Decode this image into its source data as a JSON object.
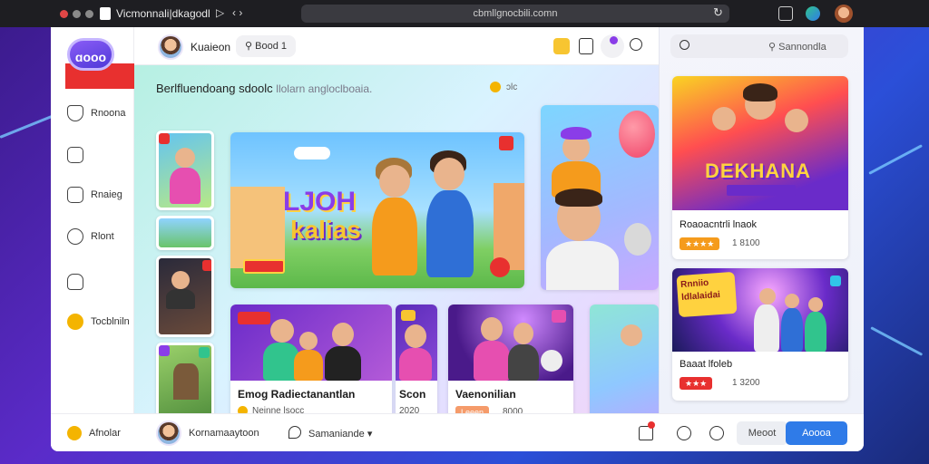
{
  "window": {
    "title": "Vicmonnali|dkagodl",
    "url": "cbmllgnocbili.comn"
  },
  "sidebar": {
    "logo": "ɑooo",
    "items": [
      {
        "label": "Rnoona",
        "icon": "shield-icon"
      },
      {
        "label": "",
        "icon": "home-icon"
      },
      {
        "label": "Rnaieg",
        "icon": "gift-icon"
      },
      {
        "label": "Rlont",
        "icon": "smile-icon"
      },
      {
        "label": "",
        "icon": "bookmark-icon"
      },
      {
        "label": "Tocblniln",
        "icon": "coin-icon"
      }
    ]
  },
  "header": {
    "user_name": "Kuaieon",
    "pill_label": "Bood 1"
  },
  "search": {
    "placeholder": "Sannondla"
  },
  "main": {
    "section_title": "Berlfluendoang sdoolc",
    "section_sub": "llolarn angloclboaia.",
    "section_badge": "ɔlc",
    "hero": {
      "title_line1": "LJOH",
      "title_line2": "kalias"
    },
    "cards": [
      {
        "title": "Emog Radiectanantlan",
        "meta": "Neinne lsocc"
      },
      {
        "title": "Scon",
        "meta": "2020"
      },
      {
        "title": "Vaenonilian",
        "tag": "Leeen",
        "meta": "8000"
      }
    ]
  },
  "right_panel": {
    "cards": [
      {
        "image_text": "DEKHANA",
        "title": "Roaoacntrli lnaok",
        "rating": "★★★★",
        "meta": "1 8100"
      },
      {
        "image_text": "Rnniio ldlalaidai",
        "title": "Baaat lfoleb",
        "tag": "★★★",
        "meta": "1 3200"
      }
    ]
  },
  "footer": {
    "label1": "Afnolar",
    "user": "Kornamaaytoon",
    "label2": "Samaniande",
    "btn_secondary": "Meoot",
    "btn_primary": "Aoooa"
  },
  "colors": {
    "accent": "#2f7be8",
    "danger": "#e8302f",
    "topbar": "#1e1e22"
  }
}
